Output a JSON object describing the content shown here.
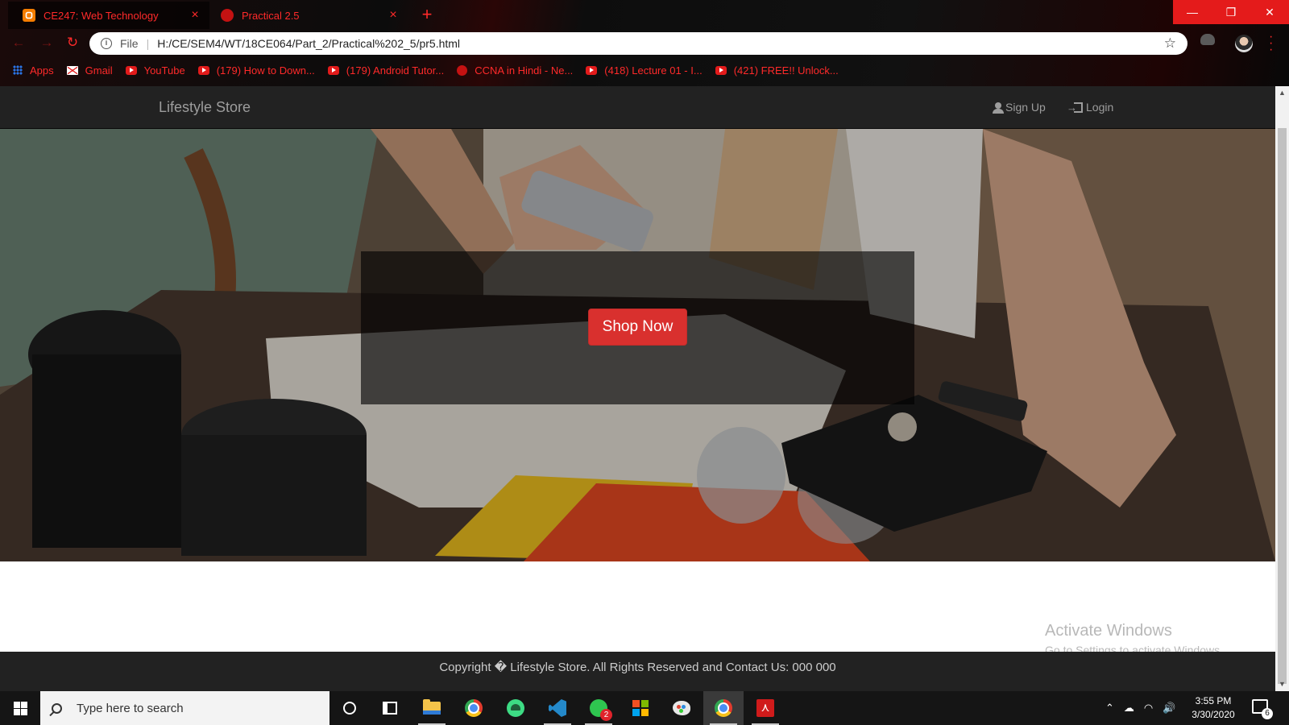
{
  "browser": {
    "tabs": [
      {
        "title": "CE247: Web Technology",
        "active": true,
        "icon": "blogger-icon"
      },
      {
        "title": "Practical 2.5",
        "active": false,
        "icon": "globe-icon"
      }
    ],
    "new_tab": "+",
    "omnibox": {
      "scheme_label": "File",
      "separator": "|",
      "url": "H:/CE/SEM4/WT/18CE064/Part_2/Practical%202_5/pr5.html"
    },
    "bookmarks": [
      {
        "label": "Apps",
        "icon": "apps-grid-icon"
      },
      {
        "label": "Gmail",
        "icon": "gmail-icon"
      },
      {
        "label": "YouTube",
        "icon": "youtube-icon"
      },
      {
        "label": "(179) How to Down...",
        "icon": "youtube-icon"
      },
      {
        "label": "(179) Android Tutor...",
        "icon": "youtube-icon"
      },
      {
        "label": "CCNA in Hindi - Ne...",
        "icon": "globe-icon"
      },
      {
        "label": "(418) Lecture 01 - I...",
        "icon": "youtube-icon"
      },
      {
        "label": "(421) FREE!! Unlock...",
        "icon": "youtube-icon"
      }
    ],
    "accent_color": "#ff2a2a"
  },
  "site": {
    "brand": "Lifestyle Store",
    "nav": {
      "signup_label": "Sign Up",
      "login_label": "Login"
    },
    "banner": {
      "button_label": "Shop Now",
      "button_color": "#d9302e"
    },
    "footer": {
      "text": "Copyright � Lifestyle Store. All Rights Reserved and Contact Us: 000 000"
    }
  },
  "watermark": {
    "line1": "Activate Windows",
    "line2": "Go to Settings to activate Windows."
  },
  "taskbar": {
    "search_placeholder": "Type here to search",
    "apps": [
      "cortana",
      "task-view",
      "file-explorer",
      "chrome",
      "android-studio",
      "vscode",
      "whatsapp",
      "microsoft-store",
      "paint",
      "chrome",
      "acrobat"
    ],
    "whatsapp_badge": "2",
    "time": "3:55 PM",
    "date": "3/30/2020",
    "notification_count": "6"
  }
}
